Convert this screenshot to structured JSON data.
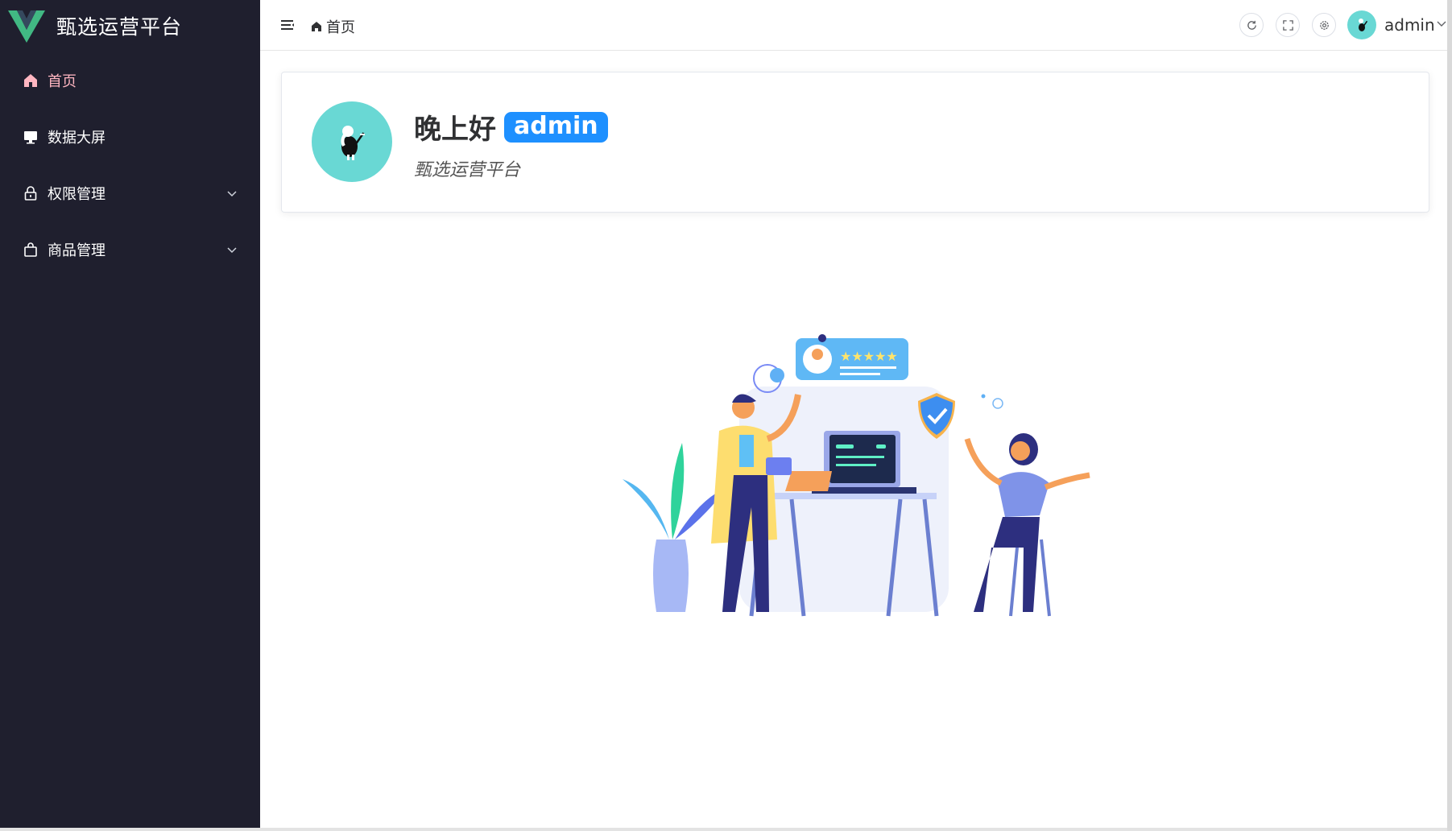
{
  "app": {
    "title": "甄选运营平台"
  },
  "sidebar": {
    "items": [
      {
        "label": "首页",
        "icon": "home-icon",
        "active": true
      },
      {
        "label": "数据大屏",
        "icon": "monitor-icon"
      },
      {
        "label": "权限管理",
        "icon": "lock-icon",
        "expandable": true
      },
      {
        "label": "商品管理",
        "icon": "shopping-bag-icon",
        "expandable": true
      }
    ]
  },
  "header": {
    "breadcrumb": "首页",
    "username": "admin",
    "tools": [
      "refresh-icon",
      "fullscreen-icon",
      "settings-icon"
    ]
  },
  "welcome": {
    "greeting": "晚上好",
    "username": "admin",
    "subtitle": "甄选运营平台"
  },
  "colors": {
    "sidebar_bg": "#1f1f2e",
    "active_menu": "#ffb6c1",
    "accent": "#1e90ff",
    "avatar_bg": "#69d8d4"
  }
}
